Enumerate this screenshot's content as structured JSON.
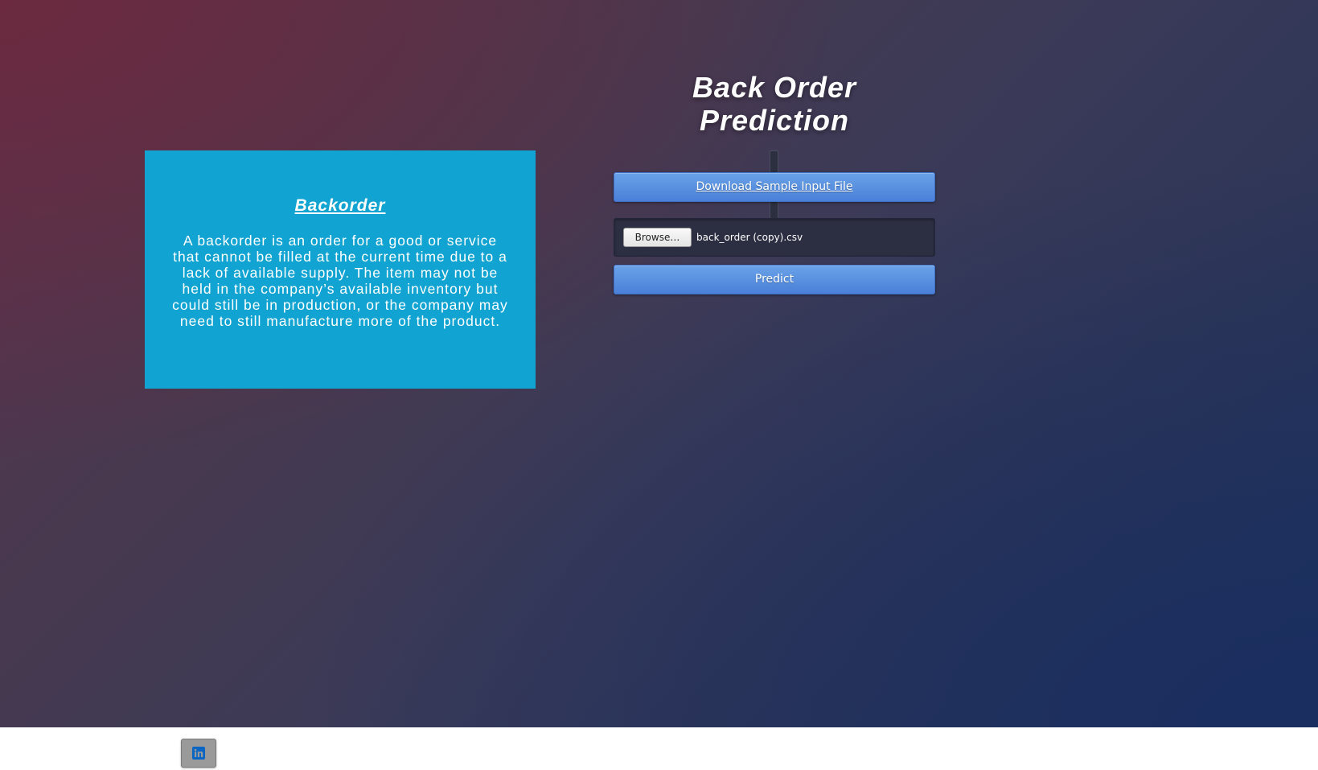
{
  "header": {
    "title_line1": "Back Order",
    "title_line2": "Prediction"
  },
  "info_card": {
    "heading": "Backorder",
    "body": "A backorder is an order for a good or service that cannot be filled at the current time due to a lack of available supply. The item may not be held in the company’s available inventory but could still be in production, or the company may need to still manufacture more of the product."
  },
  "actions": {
    "download_label": "Download Sample Input File",
    "browse_label": "Browse…",
    "selected_file": "back_order (copy).csv",
    "predict_label": "Predict"
  },
  "footer": {
    "social_icon": "linkedin-icon"
  },
  "colors": {
    "card_background": "#11a3d1",
    "button_blue": "#4a80d8",
    "file_box": "#2c2f42",
    "linkedin_brand": "#0a66c2"
  }
}
